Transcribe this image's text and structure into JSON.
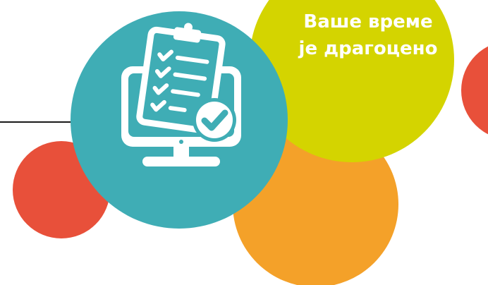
{
  "headline": {
    "line1": "Ваше време",
    "line2": "је драгоцено"
  },
  "icons": {
    "main": "survey-monitor-icon",
    "clipboard": "clipboard-checklist-icon",
    "check": "check-badge-icon"
  },
  "colors": {
    "teal": "#3fadb5",
    "yellow": "#d4d400",
    "orange": "#f4a129",
    "red": "#e8503a",
    "white": "#ffffff",
    "rule": "#1a1a1a"
  }
}
